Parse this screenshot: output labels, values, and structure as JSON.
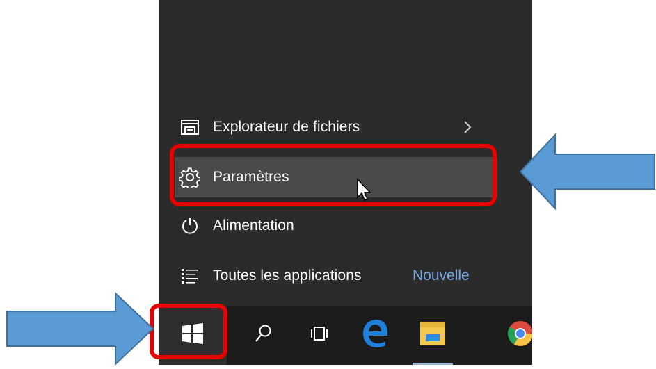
{
  "start_menu": {
    "items": [
      {
        "label": "Explorateur de fichiers",
        "icon": "file-explorer-icon"
      },
      {
        "label": "Paramètres",
        "icon": "gear-icon"
      },
      {
        "label": "Alimentation",
        "icon": "power-icon"
      },
      {
        "label": "Toutes les applications",
        "icon": "all-apps-list-icon"
      }
    ],
    "new_badge": "Nouvelle"
  },
  "taskbar": {
    "buttons": [
      "windows-start-icon",
      "search-icon",
      "task-view-icon",
      "edge-icon",
      "file-explorer-icon",
      "chrome-icon"
    ]
  },
  "colors": {
    "menu_bg": "#2b2b2b",
    "taskbar_bg": "#1c1c1c",
    "hover_bg": "#4a4a4a",
    "accent_text": "#78a6e0",
    "highlight_red": "#e60000",
    "arrow_blue": "#5b9bd5"
  }
}
